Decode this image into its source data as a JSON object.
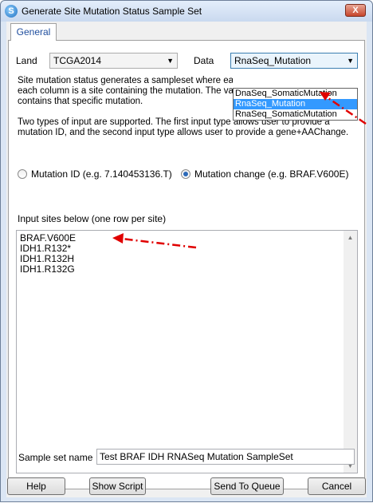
{
  "window": {
    "title": "Generate Site Mutation Status Sample Set",
    "close_label": "X"
  },
  "tabs": [
    {
      "label": "General"
    }
  ],
  "land": {
    "label": "Land",
    "value": "TCGA2014"
  },
  "data": {
    "label": "Data",
    "value": "RnaSeq_Mutation",
    "options": [
      "DnaSeq_SomaticMutation",
      "RnaSeq_Mutation",
      "RnaSeq_SomaticMutation"
    ],
    "selected_index": 1
  },
  "description": {
    "line1": "Site mutation status generates a sampleset where each",
    "line2": "each column is a site containing the mutation. The valu",
    "line3": "contains that specific mutation.",
    "line4": "Two types of input are supported. The first input type allows user to provide a",
    "line5": "mutation ID, and the second input type allows user to provide a gene+AAChange."
  },
  "input_type": {
    "option1": "Mutation ID (e.g. 7.140453136.T)",
    "option2": "Mutation change (e.g. BRAF.V600E)",
    "selected": "option2"
  },
  "sites": {
    "label": "Input sites below (one row per site)",
    "lines": [
      "BRAF.V600E",
      "IDH1.R132*",
      "IDH1.R132H",
      "IDH1.R132G"
    ]
  },
  "sample_set": {
    "label": "Sample set name",
    "value": "Test BRAF IDH RNASeq Mutation SampleSet"
  },
  "buttons": {
    "help": "Help",
    "show_script": "Show Script",
    "send": "Send To Queue",
    "cancel": "Cancel"
  },
  "colors": {
    "annotation_arrow": "#e00000",
    "selection": "#3399ff"
  },
  "icons": {
    "app": "app-icon",
    "combo_arrow": "chevron-down-icon",
    "scroll_up": "scroll-up-icon",
    "scroll_down": "scroll-down-icon"
  }
}
